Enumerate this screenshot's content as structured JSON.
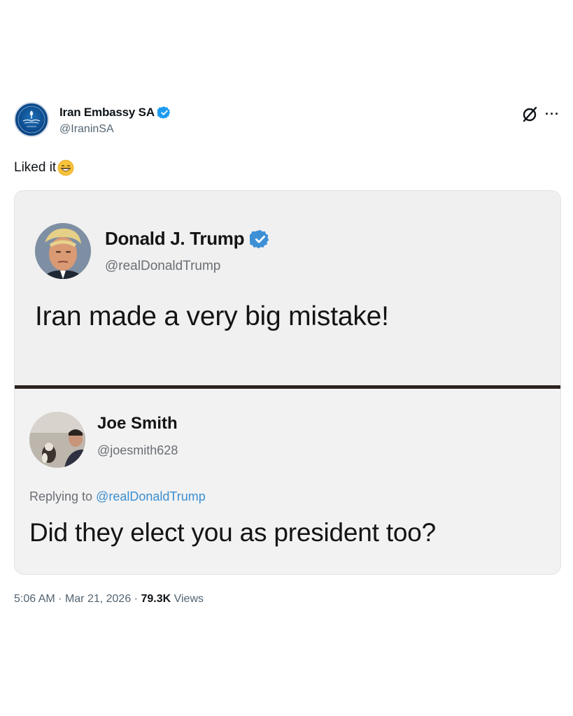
{
  "post": {
    "author_name": "Iran Embassy SA",
    "author_handle": "@IraninSA",
    "text": "Liked it",
    "emoji": "grinning-face-emoji",
    "time": "5:06 AM",
    "date": "Mar 21, 2026",
    "views_count": "79.3K",
    "views_label": "Views",
    "separator": "·"
  },
  "embedded": {
    "top_tweet": {
      "name": "Donald J. Trump",
      "handle": "@realDonaldTrump",
      "text": "Iran made a very big mistake!"
    },
    "reply_tweet": {
      "name": "Joe Smith",
      "handle": "@joesmith628",
      "replying_prefix": "Replying to",
      "replying_to": "@realDonaldTrump",
      "text": "Did they elect you as president too?"
    }
  },
  "icons": {
    "verified": "verified-badge-icon",
    "grok": "grok-icon",
    "more": "more-options-icon"
  },
  "colors": {
    "verified_blue": "#1d9bf0",
    "mention_blue": "#3b8ed1",
    "muted_text": "#536471",
    "divider": "#2b2320"
  }
}
